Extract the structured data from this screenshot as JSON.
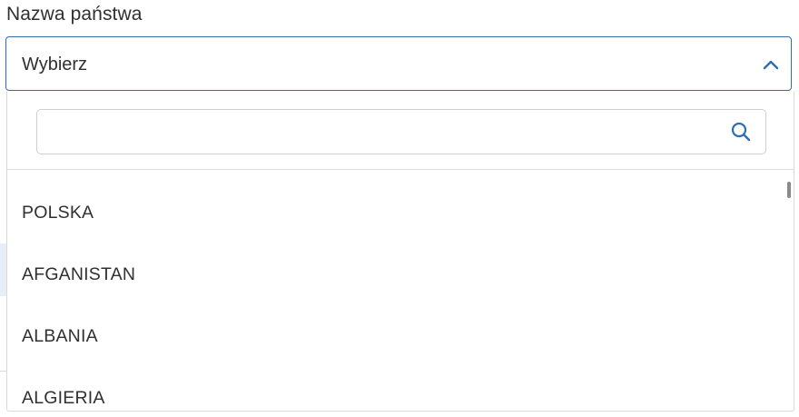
{
  "field": {
    "label": "Nazwa państwa",
    "selected_value": "Wybierz",
    "expanded": true,
    "chevron_icon": "chevron-up-icon"
  },
  "search": {
    "value": "",
    "placeholder": "",
    "icon": "search-icon"
  },
  "options": [
    {
      "label": "POLSKA"
    },
    {
      "label": "AFGANISTAN"
    },
    {
      "label": "ALBANIA"
    },
    {
      "label": "ALGIERIA"
    }
  ],
  "colors": {
    "accent": "#2f6db1",
    "text": "#303030",
    "border": "#d9d9d9"
  }
}
